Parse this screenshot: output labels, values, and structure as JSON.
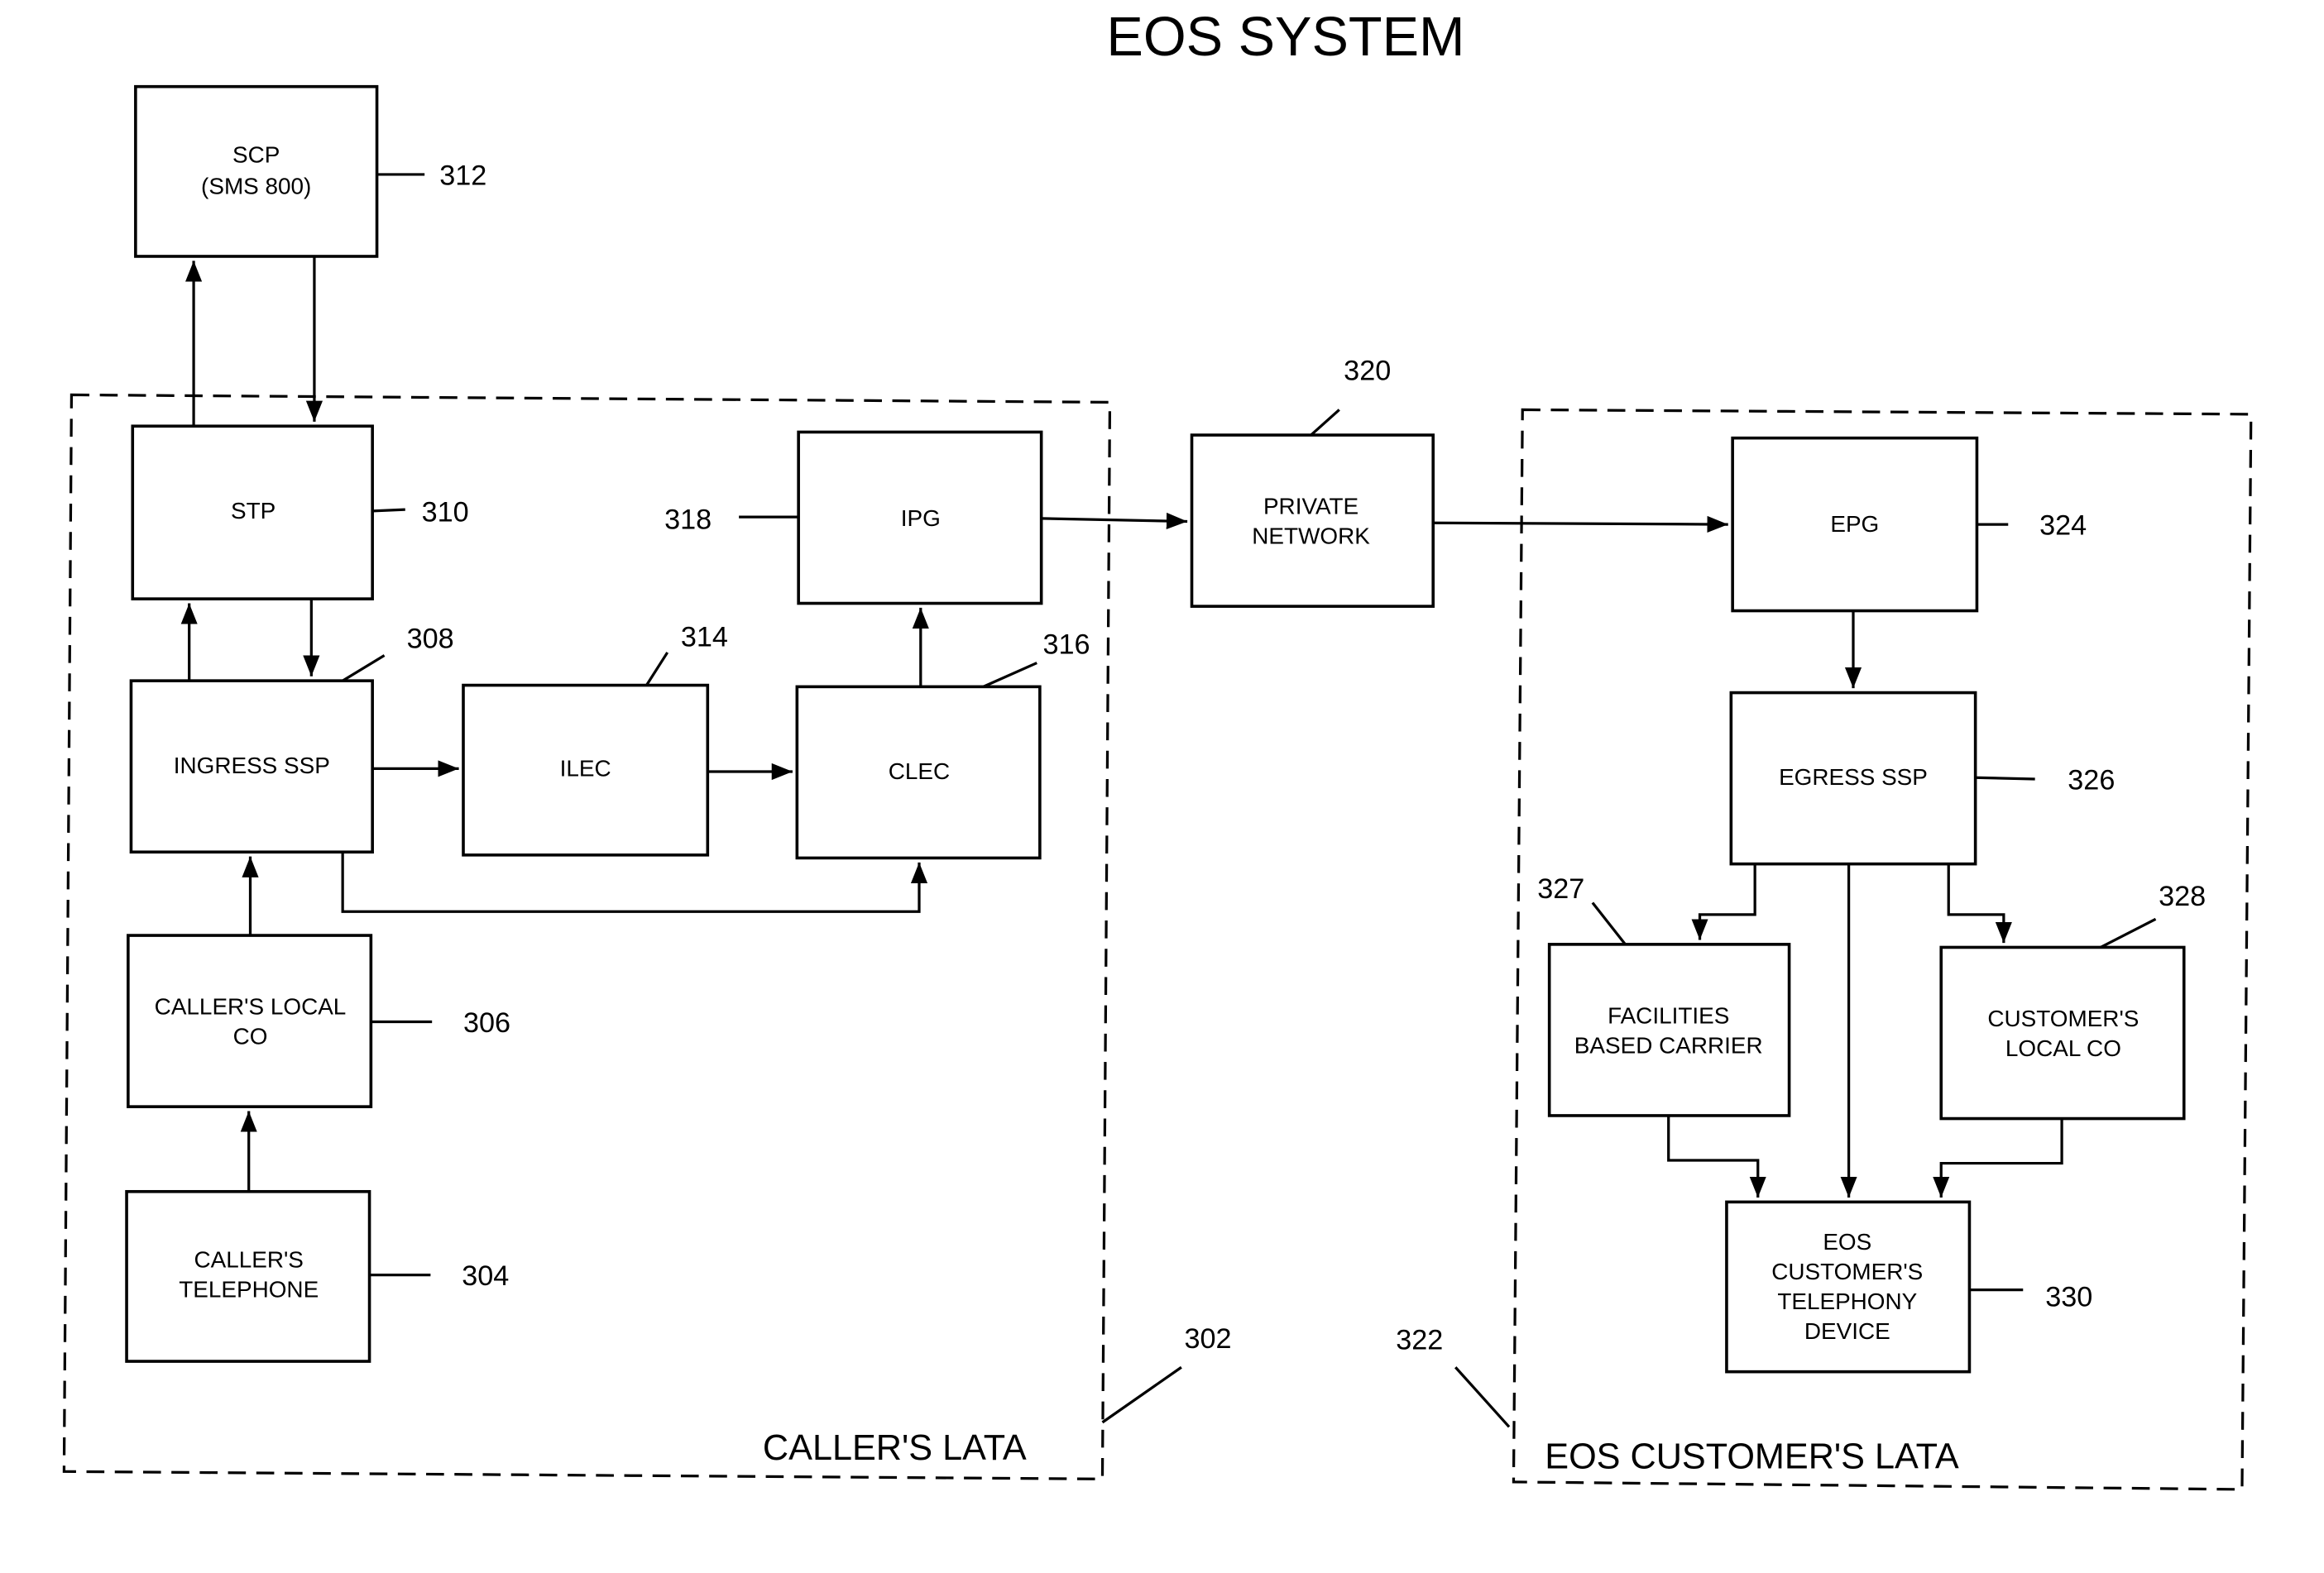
{
  "title": "EOS SYSTEM",
  "regions": {
    "callers_lata": {
      "label": "CALLER'S LATA",
      "ref": "302"
    },
    "customers_lata": {
      "label": "EOS CUSTOMER'S LATA",
      "ref": "322"
    }
  },
  "nodes": {
    "scp": {
      "lines": [
        "SCP",
        "(SMS 800)"
      ],
      "ref": "312"
    },
    "stp": {
      "lines": [
        "STP"
      ],
      "ref": "310"
    },
    "ingress_ssp": {
      "lines": [
        "INGRESS SSP"
      ],
      "ref": "308"
    },
    "ilec": {
      "lines": [
        "ILEC"
      ],
      "ref": "314"
    },
    "clec": {
      "lines": [
        "CLEC"
      ],
      "ref": "316"
    },
    "ipg": {
      "lines": [
        "IPG"
      ],
      "ref": "318"
    },
    "callers_local_co": {
      "lines": [
        "CALLER'S LOCAL",
        "CO"
      ],
      "ref": "306"
    },
    "callers_telephone": {
      "lines": [
        "CALLER'S",
        "TELEPHONE"
      ],
      "ref": "304"
    },
    "private_network": {
      "lines": [
        "PRIVATE",
        "NETWORK"
      ],
      "ref": "320"
    },
    "epg": {
      "lines": [
        "EPG"
      ],
      "ref": "324"
    },
    "egress_ssp": {
      "lines": [
        "EGRESS SSP"
      ],
      "ref": "326"
    },
    "facilities_carrier": {
      "lines": [
        "FACILITIES",
        "BASED CARRIER"
      ],
      "ref": "327"
    },
    "customers_local_co": {
      "lines": [
        "CUSTOMER'S",
        "LOCAL CO"
      ],
      "ref": "328"
    },
    "telephony_device": {
      "lines": [
        "EOS",
        "CUSTOMER'S",
        "TELEPHONY",
        "DEVICE"
      ],
      "ref": "330"
    }
  },
  "connections": [
    {
      "from": "stp",
      "to": "scp"
    },
    {
      "from": "scp",
      "to": "stp"
    },
    {
      "from": "ingress_ssp",
      "to": "stp"
    },
    {
      "from": "stp",
      "to": "ingress_ssp"
    },
    {
      "from": "callers_local_co",
      "to": "ingress_ssp"
    },
    {
      "from": "callers_telephone",
      "to": "callers_local_co"
    },
    {
      "from": "ingress_ssp",
      "to": "ilec"
    },
    {
      "from": "ilec",
      "to": "clec"
    },
    {
      "from": "ingress_ssp",
      "to": "clec"
    },
    {
      "from": "clec",
      "to": "ipg"
    },
    {
      "from": "ipg",
      "to": "private_network"
    },
    {
      "from": "private_network",
      "to": "epg"
    },
    {
      "from": "epg",
      "to": "egress_ssp"
    },
    {
      "from": "egress_ssp",
      "to": "facilities_carrier"
    },
    {
      "from": "egress_ssp",
      "to": "customers_local_co"
    },
    {
      "from": "egress_ssp",
      "to": "telephony_device"
    },
    {
      "from": "facilities_carrier",
      "to": "telephony_device"
    },
    {
      "from": "customers_local_co",
      "to": "telephony_device"
    }
  ]
}
